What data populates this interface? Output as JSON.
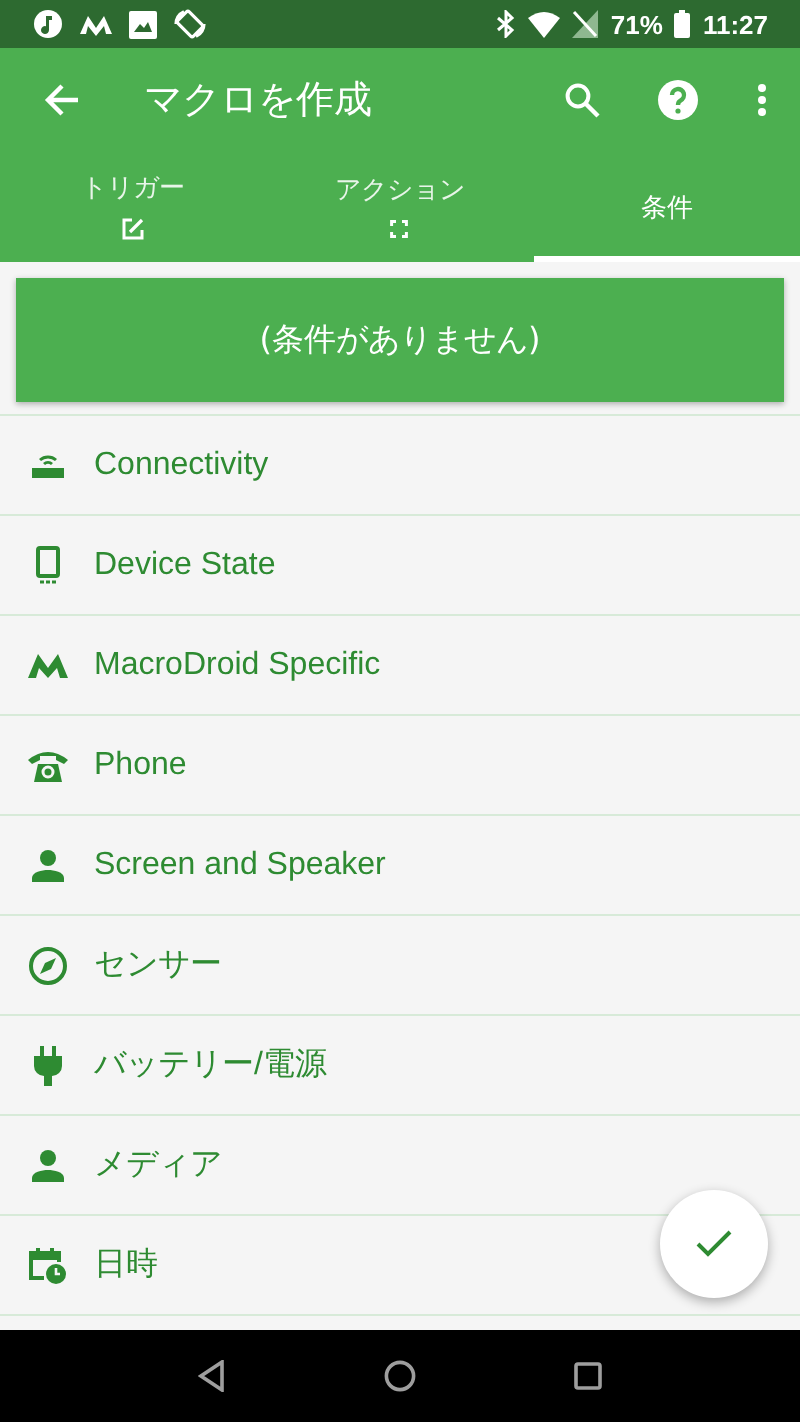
{
  "status_bar": {
    "battery": "71%",
    "time": "11:27"
  },
  "toolbar": {
    "title": "マクロを作成"
  },
  "tabs": [
    {
      "label": "トリガー",
      "kind": "edit",
      "selected": false
    },
    {
      "label": "アクション",
      "kind": "expand",
      "selected": false
    },
    {
      "label": "条件",
      "kind": "none",
      "selected": true
    }
  ],
  "empty_button": "(条件がありません)",
  "categories": [
    {
      "label": "Connectivity",
      "kind": "router"
    },
    {
      "label": "Device State",
      "kind": "phone-device"
    },
    {
      "label": "MacroDroid Specific",
      "kind": "logo"
    },
    {
      "label": "Phone",
      "kind": "telephone"
    },
    {
      "label": "Screen and Speaker",
      "kind": "person"
    },
    {
      "label": "センサー",
      "kind": "compass"
    },
    {
      "label": "バッテリー/電源",
      "kind": "plug"
    },
    {
      "label": "メディア",
      "kind": "person"
    },
    {
      "label": "日時",
      "kind": "calendar"
    }
  ]
}
